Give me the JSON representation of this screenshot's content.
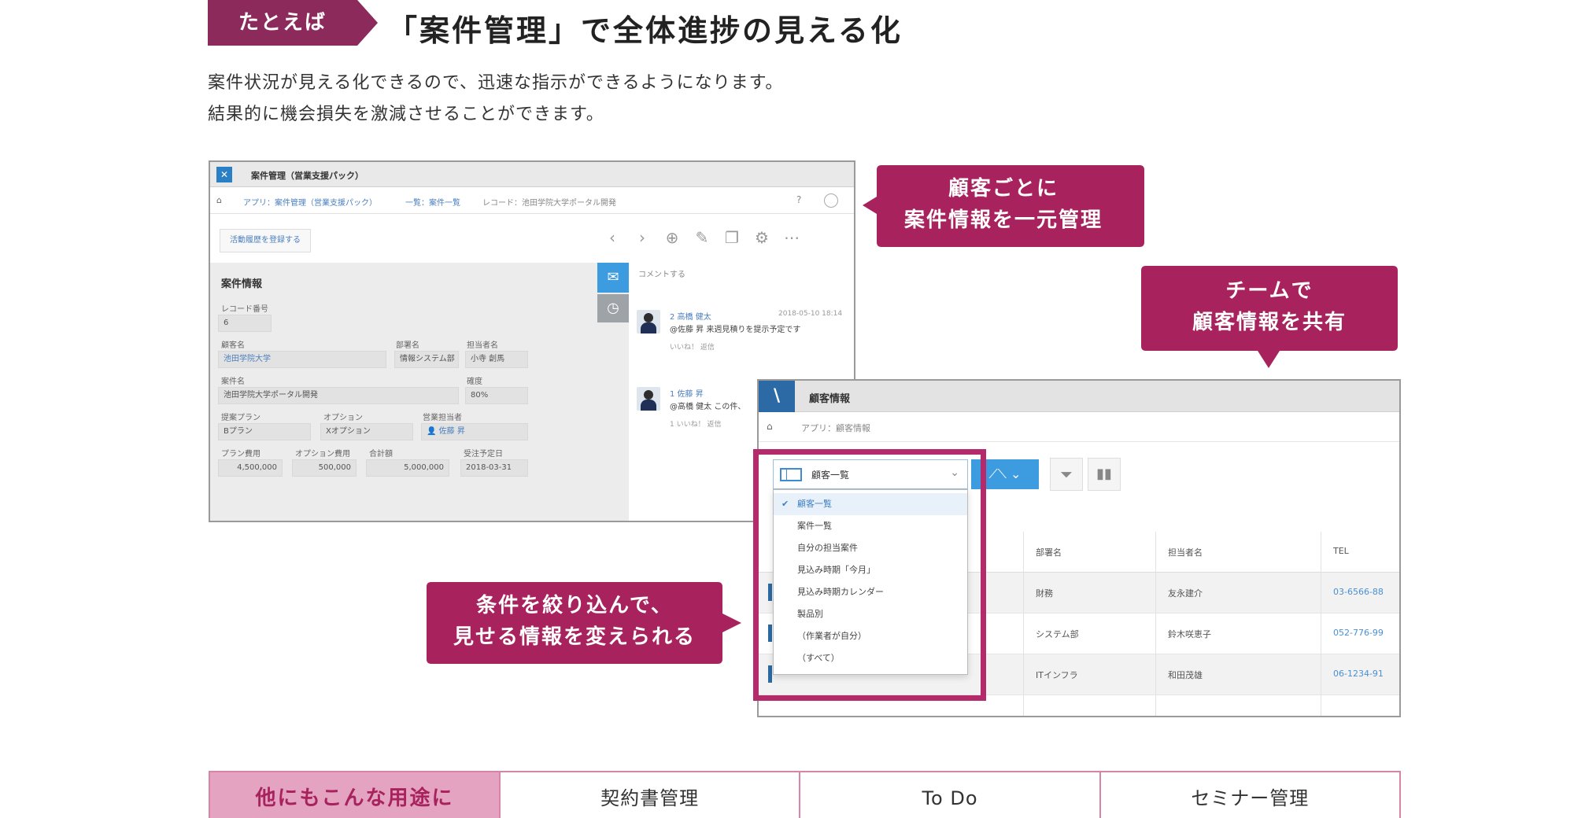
{
  "header": {
    "tag": "たとえば",
    "title": "「案件管理」で全体進捗の見える化",
    "intro_line1": "案件状況が見える化できるので、迅速な指示ができるようになります。",
    "intro_line2": "結果的に機会損失を激減させることができます。"
  },
  "colors": {
    "accent": "#a8235d",
    "ribbon": "#8c2a5c",
    "highlight": "#b52a6b",
    "button_blue": "#3d9be0"
  },
  "screen1": {
    "app_title": "案件管理（営業支援パック）",
    "breadcrumb": [
      "アプリ：案件管理（営業支援パック）",
      "一覧：案件一覧",
      "レコード：池田学院大学ポータル開発"
    ],
    "history_button": "活動履歴を登録する",
    "section_title": "案件情報",
    "fields": {
      "record_no_label": "レコード番号",
      "record_no": "6",
      "customer_label": "顧客名",
      "customer": "池田学院大学",
      "dept_label": "部署名",
      "dept": "情報システム部",
      "person_label": "担当者名",
      "person": "小寺 創馬",
      "deal_label": "案件名",
      "deal": "池田学院大学ポータル開発",
      "accuracy_label": "確度",
      "accuracy": "80%",
      "plan_label": "提案プラン",
      "plan": "Bプラン",
      "option_label": "オプション",
      "option": "Xオプション",
      "owner_label": "営業担当者",
      "owner": "佐藤 昇",
      "plan_fee_label": "プラン費用",
      "plan_fee": "4,500,000",
      "option_fee_label": "オプション費用",
      "option_fee": "500,000",
      "total_label": "合計額",
      "total": "5,000,000",
      "order_date_label": "受注予定日",
      "order_date": "2018-03-31"
    },
    "comments_header": "コメントする",
    "comments": [
      {
        "name": "2 高橋 健太",
        "date": "2018-05-10 18:14",
        "body": "@佐藤 昇 来週見積りを提示予定です",
        "likes": "いいね！  返信"
      },
      {
        "name": "1 佐藤 昇",
        "date": "",
        "body": "@高橋 健太 この件、",
        "likes": "1  いいね！  返信"
      }
    ]
  },
  "screen2": {
    "app_title": "顧客情報",
    "breadcrumb": "アプリ：顧客情報",
    "view_selected": "顧客一覧",
    "views": [
      "顧客一覧",
      "案件一覧",
      "自分の担当案件",
      "見込み時期「今月」",
      "見込み時期カレンダー",
      "製品別",
      "（作業者が自分）",
      "（すべて）"
    ],
    "table_headers": [
      "部署名",
      "担当者名",
      "TEL"
    ],
    "rows": [
      {
        "dept": "財務",
        "person": "友永建介",
        "tel": "03-6566-88"
      },
      {
        "dept": "システム部",
        "person": "鈴木咲恵子",
        "tel": "052-776-99"
      },
      {
        "dept": "ITインフラ",
        "person": "和田茂雄",
        "tel": "06-1234-91"
      }
    ]
  },
  "callouts": {
    "c1_line1": "顧客ごとに",
    "c1_line2": "案件情報を一元管理",
    "c2_line1": "チームで",
    "c2_line2": "顧客情報を共有",
    "c3_line1": "条件を絞り込んで、",
    "c3_line2": "見せる情報を変えられる"
  },
  "uses": {
    "lead": "他にもこんな用途に",
    "items": [
      "契約書管理",
      "To Do",
      "セミナー管理"
    ]
  }
}
